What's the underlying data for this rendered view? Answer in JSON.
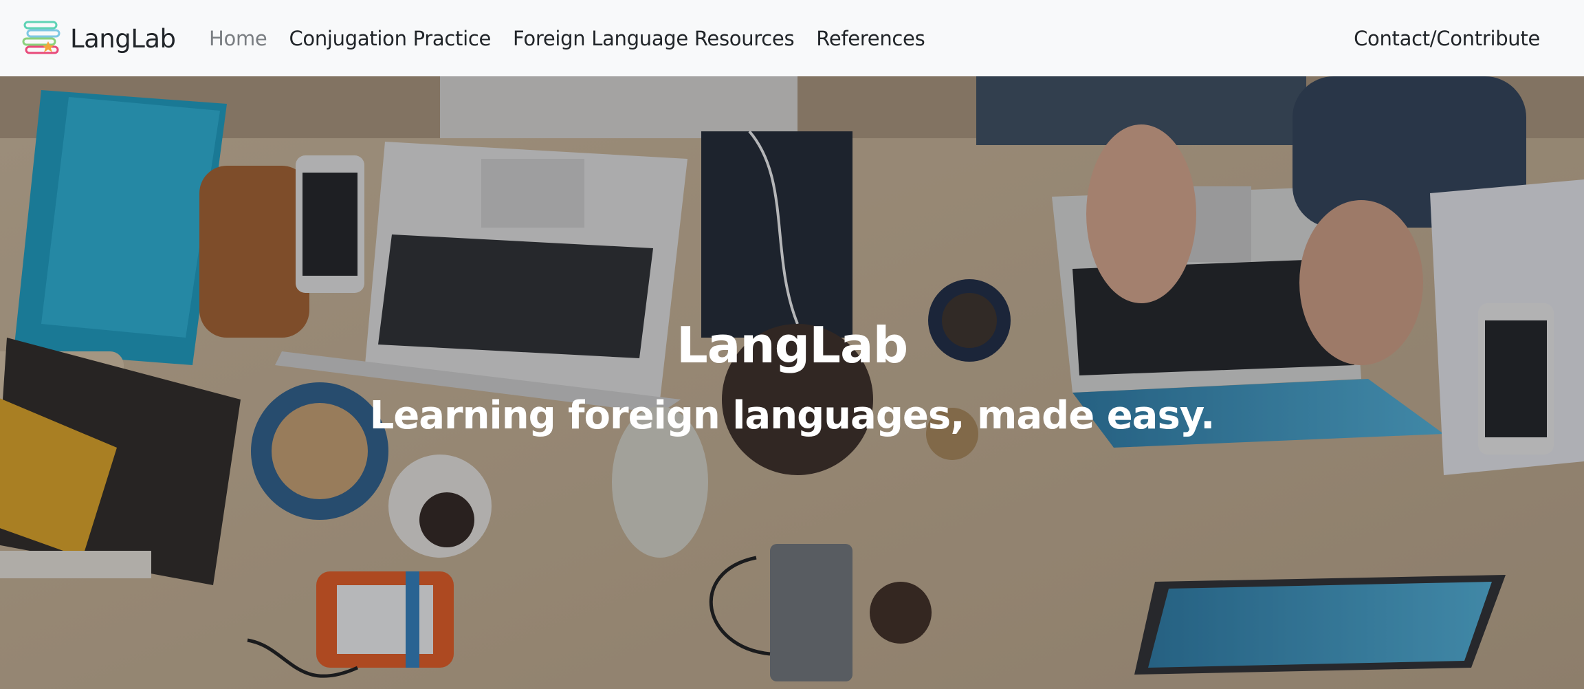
{
  "brand": {
    "name": "LangLab",
    "logo_icon": "books-stack-icon"
  },
  "nav": {
    "items": [
      {
        "label": "Home",
        "active": true
      },
      {
        "label": "Conjugation Practice",
        "active": false
      },
      {
        "label": "Foreign Language Resources",
        "active": false
      },
      {
        "label": "References",
        "active": false
      }
    ],
    "right_link": "Contact/Contribute"
  },
  "hero": {
    "title": "LangLab",
    "subtitle": "Learning foreign languages, made easy.",
    "background": "overhead-desk-with-laptops-photo"
  },
  "colors": {
    "navbar_bg": "#f8f9fa",
    "nav_text": "#212529",
    "nav_active_text": "#7a7e82",
    "hero_text": "#ffffff",
    "desk_wood": "#c9b59a"
  }
}
